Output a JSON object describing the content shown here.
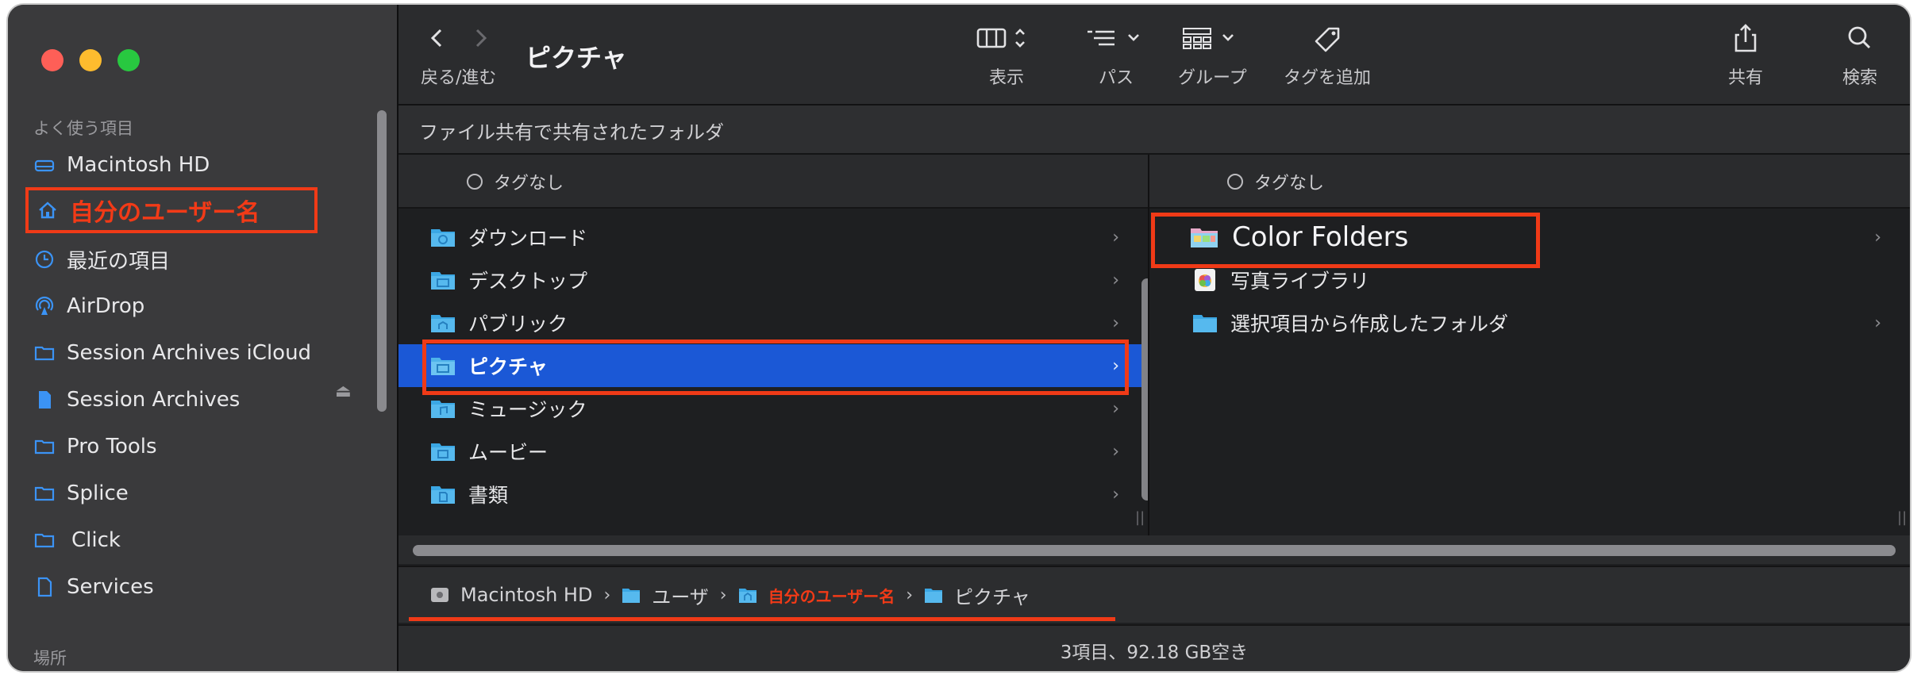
{
  "window": {
    "title": "ピクチャ"
  },
  "toolbar": {
    "back_forward_label": "戻る/進む",
    "view_label": "表示",
    "path_label": "パス",
    "group_label": "グループ",
    "add_tag_label": "タグを追加",
    "share_label": "共有",
    "search_label": "検索"
  },
  "sidebar": {
    "favorites_header": "よく使う項目",
    "locations_header": "場所",
    "items": [
      {
        "label": "Macintosh HD",
        "icon": "drive-icon"
      },
      {
        "label": "自分のユーザー名",
        "icon": "home-icon"
      },
      {
        "label": "最近の項目",
        "icon": "clock-icon"
      },
      {
        "label": "AirDrop",
        "icon": "airdrop-icon"
      },
      {
        "label": "Session Archives iCloud",
        "icon": "folder-icon"
      },
      {
        "label": "Session Archives",
        "icon": "document-icon"
      },
      {
        "label": "Pro Tools",
        "icon": "folder-icon"
      },
      {
        "label": "Splice",
        "icon": "folder-icon"
      },
      {
        "label": "Click",
        "icon": "folder-icon"
      },
      {
        "label": "Services",
        "icon": "document-icon"
      }
    ]
  },
  "shared_bar": {
    "label": "ファイル共有で共有されたフォルダ"
  },
  "column1": {
    "tag_header": "タグなし",
    "rows": [
      {
        "name": "ダウンロード",
        "icon": "downloads-folder-icon"
      },
      {
        "name": "デスクトップ",
        "icon": "desktop-folder-icon"
      },
      {
        "name": "パブリック",
        "icon": "public-folder-icon"
      },
      {
        "name": "ピクチャ",
        "icon": "pictures-folder-icon",
        "selected": true
      },
      {
        "name": "ミュージック",
        "icon": "music-folder-icon"
      },
      {
        "name": "ムービー",
        "icon": "movies-folder-icon"
      },
      {
        "name": "書類",
        "icon": "documents-folder-icon"
      }
    ]
  },
  "column2": {
    "tag_header": "タグなし",
    "rows": [
      {
        "name": "Color Folders",
        "icon": "color-folder-icon"
      },
      {
        "name": "写真ライブラリ",
        "icon": "photos-library-icon"
      },
      {
        "name": "選択項目から作成したフォルダ",
        "icon": "folder-icon"
      }
    ]
  },
  "path_bar": {
    "items": [
      "Macintosh HD",
      "ユーザ",
      "自分のユーザー名",
      "ピクチャ"
    ],
    "separator": "›"
  },
  "status_bar": {
    "text": "3項目、92.18 GB空き"
  },
  "colors": {
    "highlight_red": "#f03a17",
    "selection_blue": "#1b58d6",
    "folder_blue": "#3ba7e4"
  }
}
